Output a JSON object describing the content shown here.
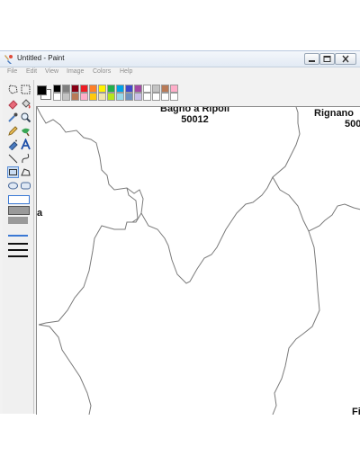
{
  "window": {
    "title": "Untitled - Paint"
  },
  "menu": {
    "items": [
      "File",
      "Edit",
      "View",
      "Image",
      "Colors",
      "Help"
    ]
  },
  "tools": [
    "free-form-select-icon",
    "rect-select-icon",
    "eraser-icon",
    "fill-bucket-icon",
    "pick-color-icon",
    "magnifier-icon",
    "pencil-icon",
    "brush-icon",
    "airbrush-icon",
    "text-tool-icon",
    "line-icon",
    "curve-icon",
    "rectangle-icon",
    "polygon-icon",
    "ellipse-icon",
    "rounded-rect-icon"
  ],
  "palette": {
    "primary": "#000000",
    "secondary": "#ffffff",
    "row1": [
      "#000000",
      "#7f7f7f",
      "#880015",
      "#ed1c24",
      "#ff7f27",
      "#fff200",
      "#22b14c",
      "#00a2e8",
      "#3f48cc",
      "#a349a4",
      "#ffffff",
      "#c3c3c3",
      "#b97a57",
      "#ffaec9"
    ],
    "row2": [
      "#ffffff",
      "#c3c3c3",
      "#b97a57",
      "#ffaec9",
      "#ffc90e",
      "#efe4b0",
      "#b5e61d",
      "#99d9ea",
      "#7092be",
      "#c8bfe7",
      "#ffffff",
      "#ffffff",
      "#ffffff",
      "#ffffff"
    ]
  },
  "canvas": {
    "labels": [
      {
        "name": "Bagno a Ripoli",
        "zip": "50012"
      },
      {
        "name": "Rignano",
        "zip": "500"
      },
      {
        "name": "a"
      },
      {
        "name": "Fi"
      }
    ]
  }
}
